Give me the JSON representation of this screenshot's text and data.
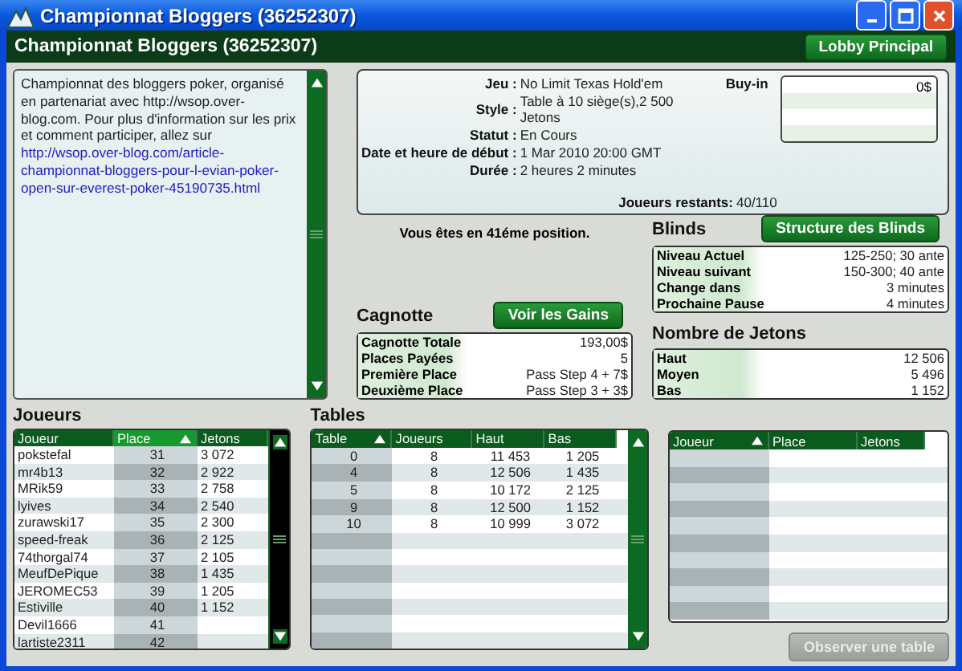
{
  "window": {
    "title": "Championnat Bloggers (36252307)"
  },
  "header": {
    "title": "Championnat Bloggers (36252307)",
    "button": "Lobby Principal"
  },
  "description": {
    "text": "Championnat des bloggers poker, organisé en partenariat avec http://wsop.over-blog.com. Pour plus d'information sur les prix et comment participer, allez sur ",
    "link": "http://wsop.over-blog.com/article-championnat-bloggers-pour-l-evian-poker-open-sur-everest-poker-45190735.html"
  },
  "info": {
    "fields": [
      {
        "label": "Jeu :",
        "value": "No Limit Texas Hold'em"
      },
      {
        "label": "Style :",
        "value": "Table à 10 siège(s),2 500 Jetons"
      },
      {
        "label": "Statut :",
        "value": "En Cours"
      },
      {
        "label": "Date et heure de début :",
        "value": "1 Mar 2010 20:00 GMT"
      },
      {
        "label": "Durée :",
        "value": "2 heures 2 minutes"
      }
    ],
    "buyin_label": "Buy-in",
    "buyin_value": "0$",
    "remaining_label": "Joueurs restants:",
    "remaining_value": "40/110"
  },
  "position": "Vous êtes en 41éme position.",
  "cagnotte": {
    "title": "Cagnotte",
    "button": "Voir les Gains",
    "rows": [
      {
        "label": "Cagnotte Totale",
        "value": "193,00$"
      },
      {
        "label": "Places Payées",
        "value": "5"
      },
      {
        "label": "Première Place",
        "value": "Pass Step 4 + 7$"
      },
      {
        "label": "Deuxième Place",
        "value": "Pass Step 3 + 3$"
      }
    ]
  },
  "blinds": {
    "title": "Blinds",
    "button": "Structure des Blinds",
    "rows": [
      {
        "label": "Niveau Actuel",
        "value": "125-250; 30 ante"
      },
      {
        "label": "Niveau suivant",
        "value": "150-300; 40 ante"
      },
      {
        "label": "Change dans",
        "value": "3 minutes"
      },
      {
        "label": "Prochaine Pause",
        "value": "4 minutes"
      }
    ]
  },
  "jetons": {
    "title": "Nombre de Jetons",
    "rows": [
      {
        "label": "Haut",
        "value": "12 506"
      },
      {
        "label": "Moyen",
        "value": "5 496"
      },
      {
        "label": "Bas",
        "value": "1 152"
      }
    ]
  },
  "players": {
    "title": "Joueurs",
    "columns": [
      {
        "label": "Joueur",
        "sorted": false
      },
      {
        "label": "Place",
        "sorted": true
      },
      {
        "label": "Jetons",
        "sorted": false
      }
    ],
    "rows": [
      [
        "pokstefal",
        "31",
        "3 072"
      ],
      [
        "mr4b13",
        "32",
        "2 922"
      ],
      [
        "MRik59",
        "33",
        "2 758"
      ],
      [
        "lyives",
        "34",
        "2 540"
      ],
      [
        "zurawski17",
        "35",
        "2 300"
      ],
      [
        "speed-freak",
        "36",
        "2 125"
      ],
      [
        "74thorgal74",
        "37",
        "2 105"
      ],
      [
        "MeufDePique",
        "38",
        "1 435"
      ],
      [
        "JEROMEC53",
        "39",
        "1 205"
      ],
      [
        "Estiville",
        "40",
        "1 152"
      ],
      [
        "Devil1666",
        "41",
        ""
      ],
      [
        "lartiste2311",
        "42",
        ""
      ]
    ]
  },
  "tables": {
    "title": "Tables",
    "columns": [
      {
        "label": "Table",
        "sorted": true
      },
      {
        "label": "Joueurs",
        "sorted": false
      },
      {
        "label": "Haut",
        "sorted": false
      },
      {
        "label": "Bas",
        "sorted": false
      }
    ],
    "rows": [
      [
        "0",
        "8",
        "11 453",
        "1 205"
      ],
      [
        "4",
        "8",
        "12 506",
        "1 435"
      ],
      [
        "5",
        "8",
        "10 172",
        "2 125"
      ],
      [
        "9",
        "8",
        "12 500",
        "1 152"
      ],
      [
        "10",
        "8",
        "10 999",
        "3 072"
      ]
    ]
  },
  "table_players": {
    "columns": [
      {
        "label": "Joueur",
        "sorted": true
      },
      {
        "label": "Place",
        "sorted": false
      },
      {
        "label": "Jetons",
        "sorted": false
      }
    ]
  },
  "observe_button": {
    "label": "Observer une table",
    "disabled": true
  }
}
